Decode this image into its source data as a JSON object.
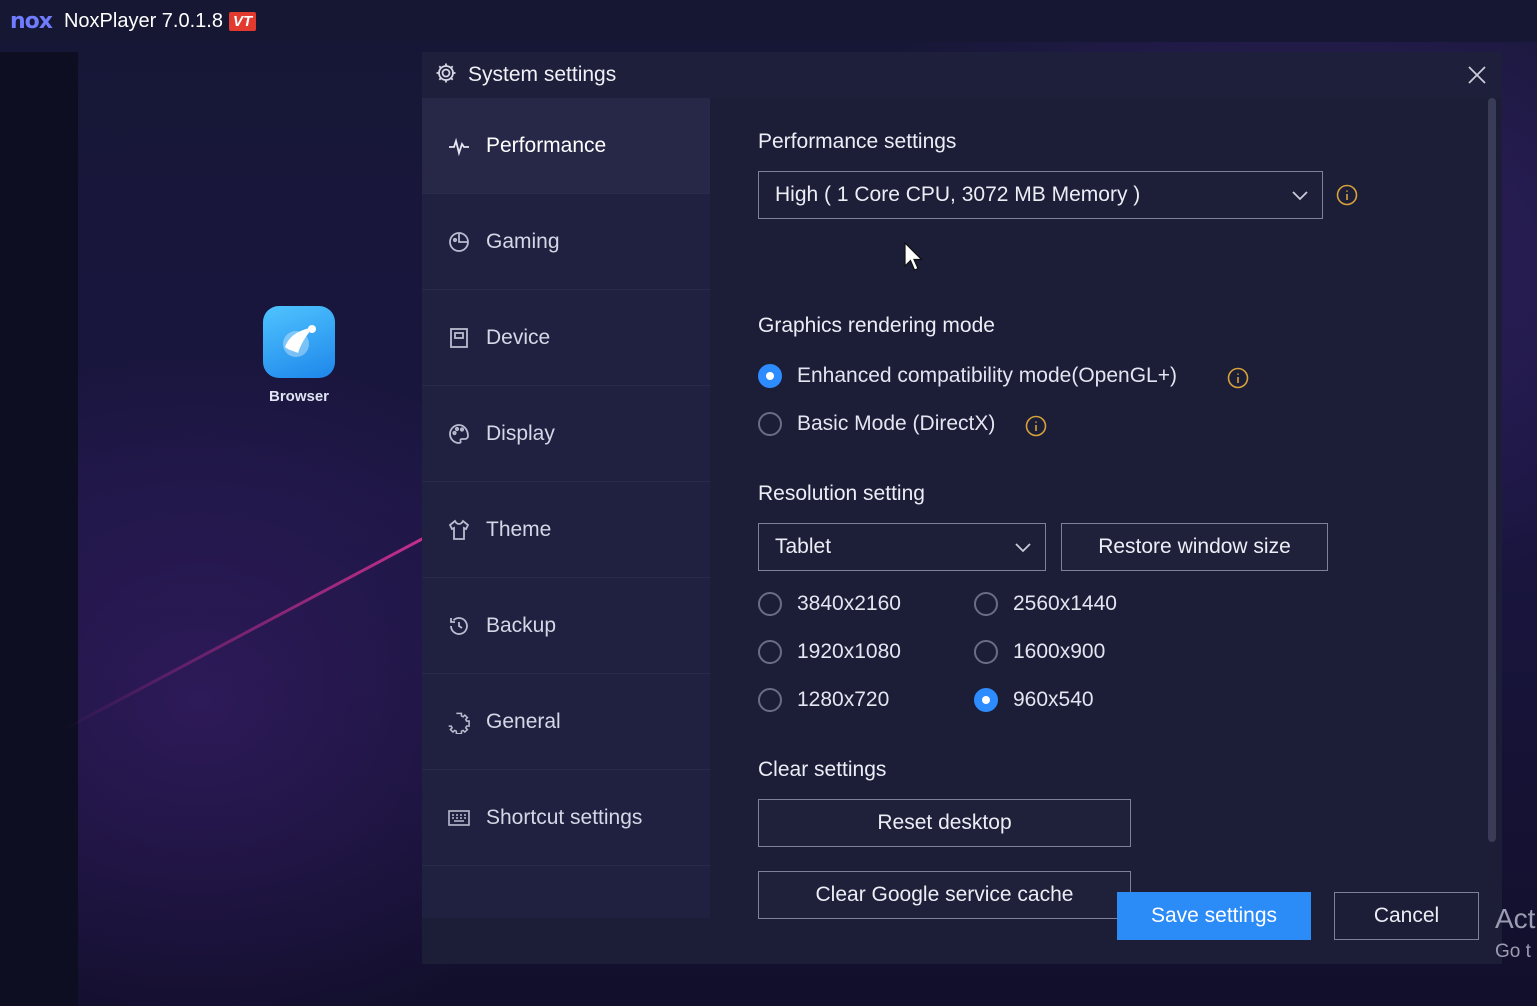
{
  "app": {
    "logo_text": "nox",
    "title": "NoxPlayer 7.0.1.8",
    "vt_badge": "VT"
  },
  "desktop": {
    "icons": [
      {
        "label": "Browser",
        "icon": "browser-icon"
      }
    ]
  },
  "dialog": {
    "title": "System settings",
    "title_icon": "gear-icon",
    "close_icon": "close-icon"
  },
  "sidebar": {
    "items": [
      {
        "label": "Performance",
        "icon": "performance-icon",
        "active": true
      },
      {
        "label": "Gaming",
        "icon": "gaming-icon"
      },
      {
        "label": "Device",
        "icon": "device-icon"
      },
      {
        "label": "Display",
        "icon": "display-icon"
      },
      {
        "label": "Theme",
        "icon": "theme-icon"
      },
      {
        "label": "Backup",
        "icon": "backup-icon"
      },
      {
        "label": "General",
        "icon": "general-icon"
      },
      {
        "label": "Shortcut settings",
        "icon": "keyboard-icon"
      }
    ]
  },
  "performance": {
    "title": "Performance settings",
    "selected": "High ( 1 Core CPU, 3072 MB Memory )"
  },
  "graphics": {
    "title": "Graphics rendering mode",
    "options": [
      {
        "label": "Enhanced compatibility mode(OpenGL+)",
        "selected": true
      },
      {
        "label": "Basic Mode (DirectX)",
        "selected": false
      }
    ]
  },
  "resolution": {
    "title": "Resolution setting",
    "selected": "Tablet",
    "restore_label": "Restore window size",
    "options": [
      {
        "label": "3840x2160",
        "selected": false
      },
      {
        "label": "2560x1440",
        "selected": false
      },
      {
        "label": "1920x1080",
        "selected": false
      },
      {
        "label": "1600x900",
        "selected": false
      },
      {
        "label": "1280x720",
        "selected": false
      },
      {
        "label": "960x540",
        "selected": true
      }
    ]
  },
  "clear": {
    "title": "Clear settings",
    "reset_label": "Reset desktop",
    "cache_label": "Clear Google service cache"
  },
  "footer": {
    "save_label": "Save settings",
    "cancel_label": "Cancel"
  },
  "watermark": {
    "line1": "Act",
    "line2": "Go t"
  },
  "colors": {
    "accent": "#2b8bf7",
    "info": "#d8a23a",
    "badge": "#e23a2f"
  }
}
